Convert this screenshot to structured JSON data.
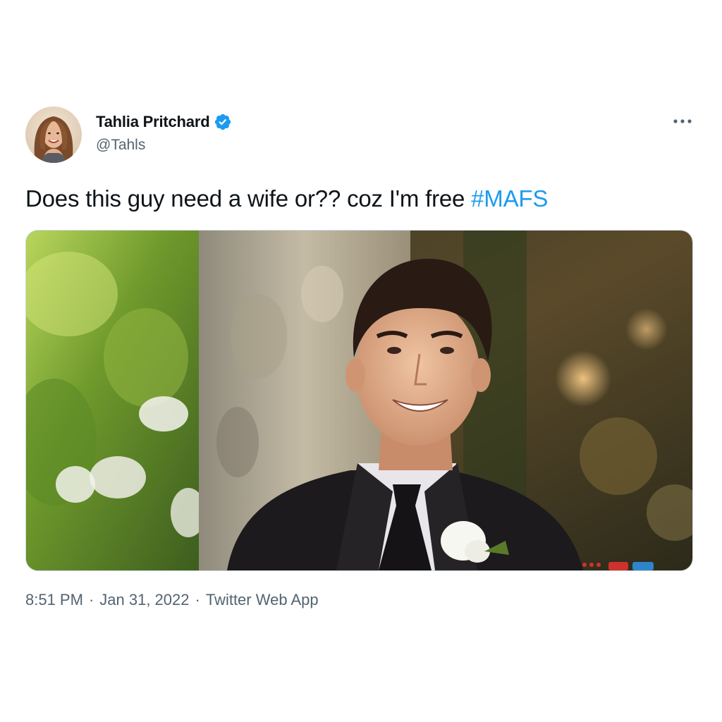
{
  "author": {
    "name": "Tahlia Pritchard",
    "handle": "@Tahls",
    "verified_color": "#1d9bf0"
  },
  "tweet": {
    "text": "Does this guy need a wife or?? coz I'm free ",
    "hashtag": "#MAFS",
    "hashtag_color": "#1d9bf0"
  },
  "meta": {
    "time": "8:51 PM",
    "separator": "·",
    "date": "Jan 31, 2022",
    "source": "Twitter Web App"
  },
  "icons": {
    "more": "more-horizontal-icon",
    "verified": "verified-badge-icon"
  }
}
